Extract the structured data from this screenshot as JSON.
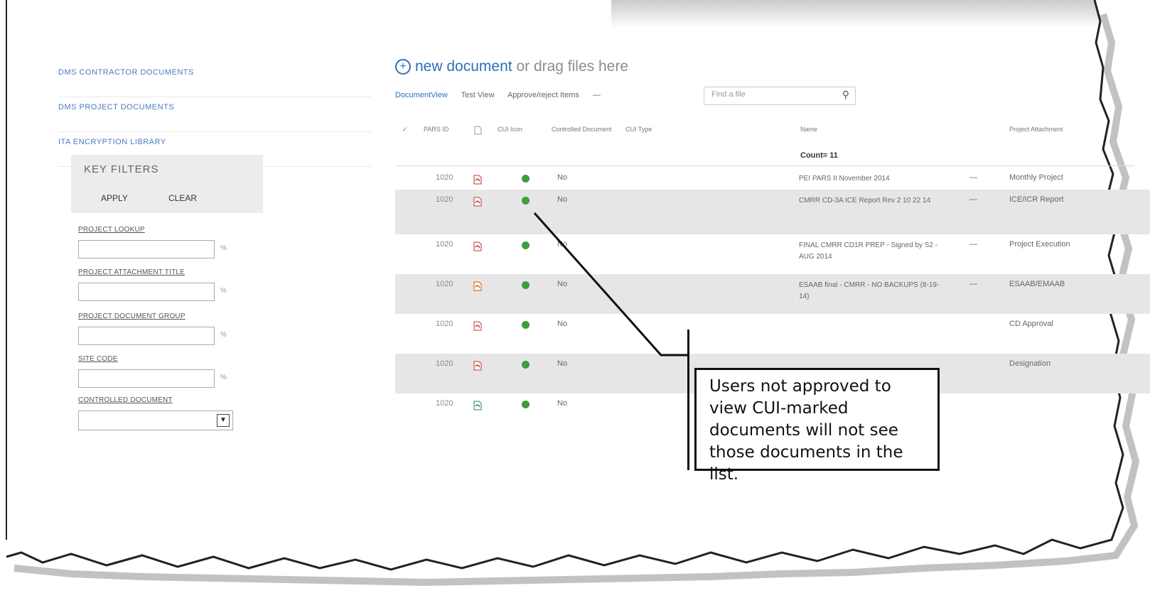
{
  "sidebar": {
    "links": [
      "DMS CONTRACTOR DOCUMENTS",
      "DMS PROJECT DOCUMENTS",
      "ITA ENCRYPTION LIBRARY"
    ],
    "key_filters": {
      "title": "KEY FILTERS",
      "apply": "APPLY",
      "clear": "CLEAR"
    },
    "fields": [
      {
        "label": "PROJECT LOOKUP",
        "suffix": "%"
      },
      {
        "label": "PROJECT ATTACHMENT TITLE",
        "suffix": "%"
      },
      {
        "label": "PROJECT DOCUMENT GROUP",
        "suffix": "%"
      },
      {
        "label": "SITE CODE",
        "suffix": "%"
      }
    ],
    "controlled_document": {
      "label": "CONTROLLED DOCUMENT",
      "value": ""
    }
  },
  "toolbar": {
    "new_document": "new document",
    "drag_text": "or drag files here",
    "views": [
      "DocumentView",
      "Test View",
      "Approve/reject Items",
      "—"
    ],
    "find_placeholder": "Find a file"
  },
  "table": {
    "headers": {
      "check": "✓",
      "pars_id": "PARS ID",
      "type": "",
      "cui_icon": "CUI Icon",
      "controlled": "Controlled Document",
      "cui_type": "CUI Type",
      "name": "Name",
      "attachment": "Project Attachment"
    },
    "count": "Count= 11",
    "rows": [
      {
        "pars_id": "1020",
        "icon": "pdf",
        "controlled": "No",
        "name": "PEI PARS II November 2014",
        "dash": "—",
        "attachment": "Monthly Project"
      },
      {
        "pars_id": "1020",
        "icon": "pdf",
        "controlled": "No",
        "name": "CMRR CD-3A ICE Report Rev 2 10 22 14",
        "dash": "—",
        "attachment": "ICE/ICR Report"
      },
      {
        "pars_id": "1020",
        "icon": "pdf",
        "controlled": "No",
        "name": "FINAL CMRR CD1R PREP - Signed by S2 - AUG 2014",
        "dash": "—",
        "attachment": "Project Execution"
      },
      {
        "pars_id": "1020",
        "icon": "ppt",
        "controlled": "No",
        "name": "ESAAB final - CMRR - NO BACKUPS (8-19-14)",
        "dash": "—",
        "attachment": "ESAAB/EMAAB"
      },
      {
        "pars_id": "1020",
        "icon": "pdf",
        "controlled": "No",
        "name": "",
        "dash": "",
        "attachment": "CD Approval"
      },
      {
        "pars_id": "1020",
        "icon": "pdf",
        "controlled": "No",
        "name": "",
        "dash": "",
        "attachment": "Designation"
      },
      {
        "pars_id": "1020",
        "icon": "xls",
        "controlled": "No",
        "name": "",
        "dash": "",
        "attachment": ""
      }
    ]
  },
  "callout": {
    "text": "Users not approved to view CUI-marked documents will not see those documents in the list."
  }
}
